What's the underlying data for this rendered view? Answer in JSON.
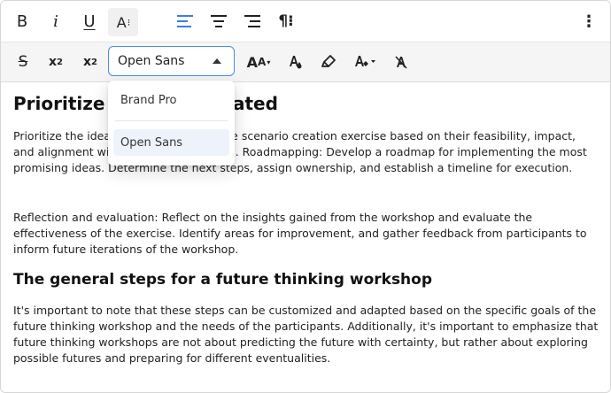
{
  "toolbar_top": {
    "bold": "B",
    "italic": "i",
    "underline": "U",
    "text_size": "A",
    "text_size_dots": "⁝",
    "paragraph": "¶⁝",
    "more": "⋮"
  },
  "toolbar_format": {
    "strikethrough": "S",
    "subscript_x": "x",
    "subscript_2": "2",
    "superscript_x": "x",
    "superscript_2": "2",
    "font_value": "Open Sans",
    "case_big": "A",
    "case_small": "A",
    "case_caret": "▾"
  },
  "font_dropdown": {
    "options": [
      "Brand Pro",
      "Open Sans"
    ],
    "selected": "Open Sans"
  },
  "document": {
    "heading1": "Prioritize t",
    "heading1_tail": "ated",
    "para1": "Prioritize the ideas generated during the scenario creation exercise based on their feasibility, impact, and alignment with the future scenarios. Roadmapping: Develop a roadmap for implementing the most promising ideas. Determine the next steps, assign ownership, and establish a timeline for execution.",
    "para2": "Reflection and evaluation: Reflect on the insights gained from the workshop and evaluate the effectiveness of the exercise. Identify areas for improvement, and gather feedback from participants to inform future iterations of the workshop.",
    "heading2": "The general steps for a future thinking workshop",
    "para3": "It's important to note that these steps can be customized and adapted based on the specific goals of the future thinking workshop and the needs of the participants. Additionally, it's important to emphasize that future thinking workshops are not about predicting the future with certainty, but rather about exploring possible futures and preparing for different eventualities."
  },
  "colors": {
    "accent": "#4a8ae8",
    "toolbar_bg": "#f5f5f5",
    "selected_option_bg": "#eef3fb"
  }
}
